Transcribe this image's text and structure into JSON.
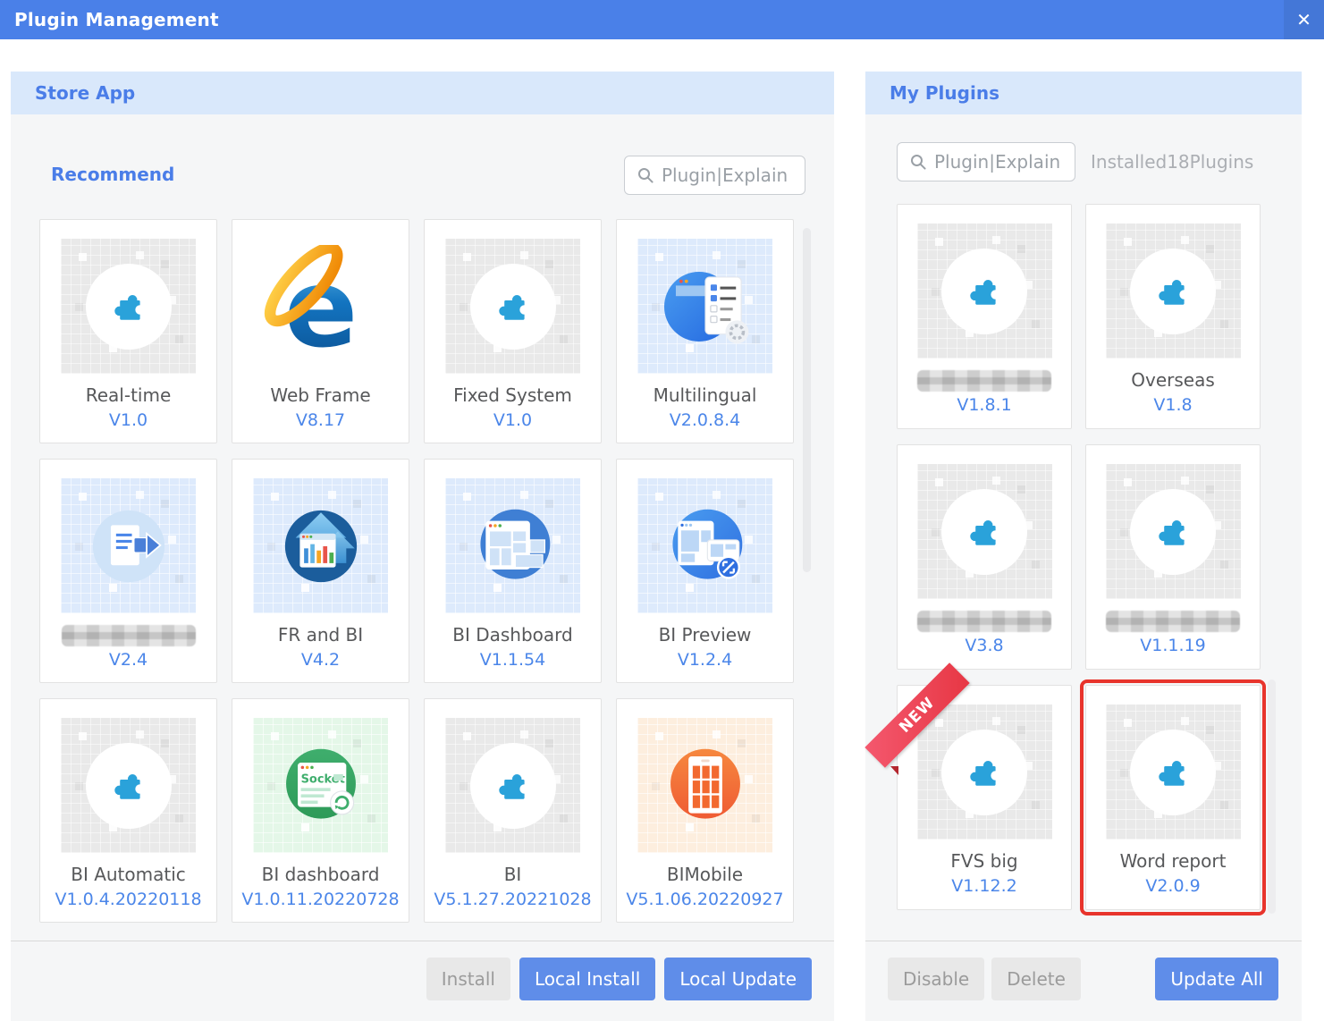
{
  "window": {
    "title": "Plugin Management",
    "close_glyph": "✕"
  },
  "colors": {
    "titlebar": "#4a80e8",
    "accent_blue": "#4a7de8",
    "version_blue": "#4b86e9",
    "highlight_red": "#e8342c",
    "puzzle_blue": "#2aa2da"
  },
  "store": {
    "header": "Store App",
    "section_label": "Recommend",
    "search": {
      "placeholder": "Plugin|Explain",
      "value": ""
    },
    "cards": [
      {
        "name": "Real-time",
        "version": "V1.0",
        "icon": "puzzle",
        "tile": "gray",
        "censored": false
      },
      {
        "name": "Web Frame",
        "version": "V8.17",
        "icon": "ie",
        "tile": "white",
        "censored": false
      },
      {
        "name": "Fixed System",
        "version": "V1.0",
        "icon": "puzzle",
        "tile": "gray",
        "censored": false
      },
      {
        "name": "Multilingual",
        "version": "V2.0.8.4",
        "icon": "checklist",
        "tile": "blue",
        "censored": false
      },
      {
        "name": "",
        "version": "V2.4",
        "icon": "doc-export",
        "tile": "blue",
        "censored": true
      },
      {
        "name": "FR and BI",
        "version": "V4.2",
        "icon": "house-chart",
        "tile": "blue",
        "censored": false
      },
      {
        "name": "BI Dashboard",
        "version": "V1.1.54",
        "icon": "dashboard",
        "tile": "blue",
        "censored": false
      },
      {
        "name": "BI Preview",
        "version": "V1.2.4",
        "icon": "preview",
        "tile": "blue",
        "censored": false
      },
      {
        "name": "BI Automatic",
        "version": "V1.0.4.20220118",
        "icon": "puzzle",
        "tile": "gray",
        "censored": false
      },
      {
        "name": "BI dashboard",
        "version": "V1.0.11.20220728",
        "icon": "socket",
        "tile": "green",
        "censored": false
      },
      {
        "name": "BI",
        "version": "V5.1.27.20221028",
        "icon": "puzzle",
        "tile": "gray",
        "censored": false
      },
      {
        "name": "BIMobile",
        "version": "V5.1.06.20220927",
        "icon": "mobile-grid",
        "tile": "orange",
        "censored": false
      }
    ],
    "buttons": [
      {
        "label": "Install",
        "style": "disabled"
      },
      {
        "label": "Local Install",
        "style": "primary"
      },
      {
        "label": "Local Update",
        "style": "primary"
      }
    ]
  },
  "my_plugins": {
    "header": "My Plugins",
    "search": {
      "placeholder": "Plugin|Explain",
      "value": ""
    },
    "installed_count_text": "Installed18Plugins",
    "cards": [
      {
        "name": "",
        "version": "V1.8.1",
        "icon": "puzzle",
        "tile": "gray",
        "censored": true
      },
      {
        "name": "Overseas",
        "version": "V1.8",
        "icon": "puzzle",
        "tile": "gray",
        "censored": false
      },
      {
        "name": "",
        "version": "V3.8",
        "icon": "puzzle",
        "tile": "gray",
        "censored": true
      },
      {
        "name": "",
        "version": "V1.1.19",
        "icon": "puzzle",
        "tile": "gray",
        "censored": true
      },
      {
        "name": "FVS big",
        "version": "V1.12.2",
        "icon": "puzzle",
        "tile": "gray",
        "censored": false,
        "ribbon": "NEW"
      },
      {
        "name": "Word report",
        "version": "V2.0.9",
        "icon": "puzzle",
        "tile": "gray",
        "censored": false,
        "highlighted": true
      }
    ],
    "buttons": [
      {
        "label": "Disable",
        "style": "disabled"
      },
      {
        "label": "Delete",
        "style": "disabled"
      },
      {
        "label": "Update All",
        "style": "primary"
      }
    ]
  }
}
